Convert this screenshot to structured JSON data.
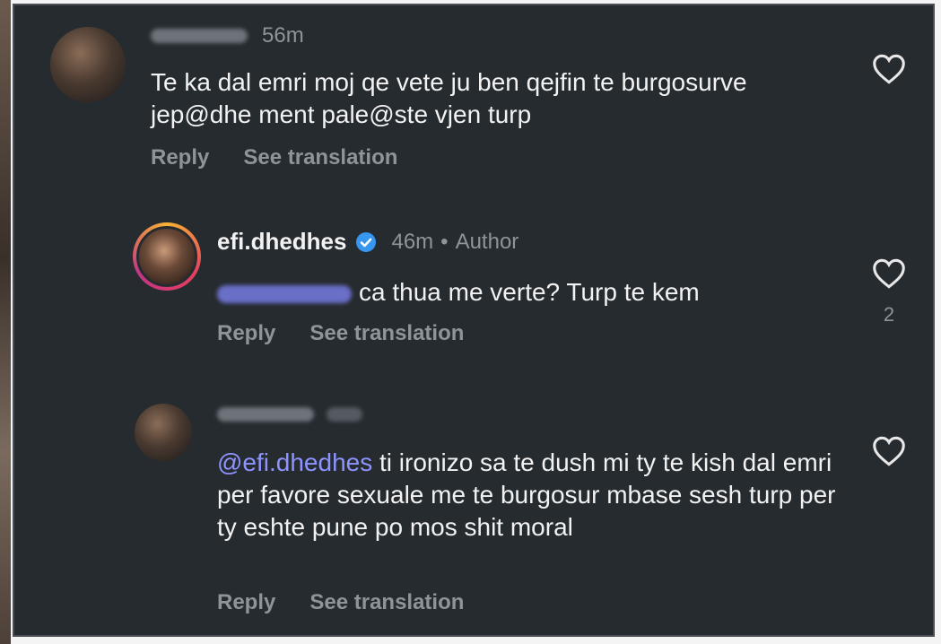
{
  "comments": [
    {
      "username": "",
      "time": "56m",
      "text": "Te ka dal emri moj qe vete ju ben qejfin te burgosurve jep@dhe ment pale@ste vjen turp",
      "actions": {
        "reply": "Reply",
        "translate": "See translation"
      },
      "likes": ""
    },
    {
      "username": "efi.dhedhes",
      "verified": true,
      "time": "46m",
      "separator": "•",
      "badge": "Author",
      "mention": "",
      "text": "ca thua me verte? Turp te kem",
      "actions": {
        "reply": "Reply",
        "translate": "See translation"
      },
      "likes": "2"
    },
    {
      "username": "",
      "time": "",
      "mention": "@efi.dhedhes",
      "text": "ti ironizo sa te dush mi ty te kish dal emri per favore sexuale me te burgosur mbase sesh turp per ty eshte pune po mos shit moral",
      "actions": {
        "reply": "Reply",
        "translate": "See translation"
      },
      "likes": ""
    }
  ],
  "icons": {
    "heart": "heart-outline-icon",
    "verified": "verified-badge-icon"
  },
  "colors": {
    "background": "#262b30",
    "text": "#f2f2f2",
    "muted": "#8f949a",
    "mention": "#8d93ff",
    "verified": "#3797f0"
  }
}
